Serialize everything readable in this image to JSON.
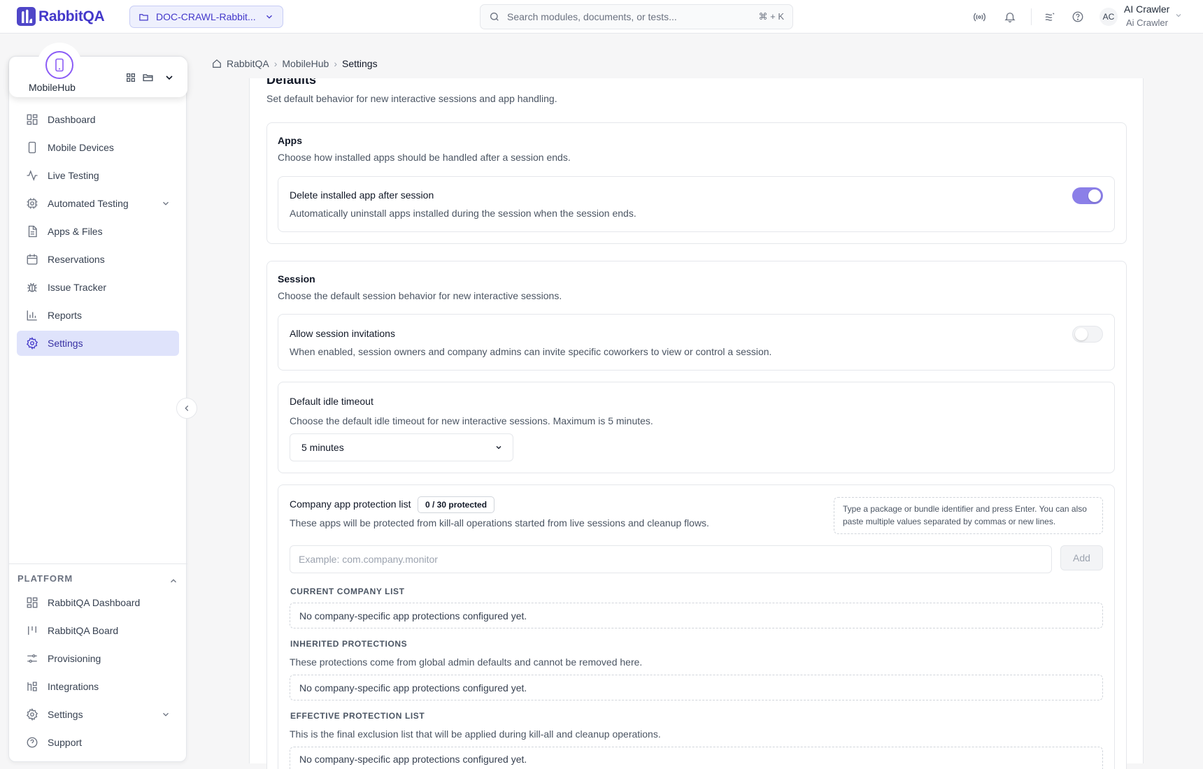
{
  "topbar": {
    "logo_text": "RabbitQA",
    "project_selector": "DOC-CRAWL-Rabbit...",
    "search_placeholder": "Search modules, documents, or tests...",
    "search_shortcut": "⌘ + K",
    "user": {
      "initials": "AC",
      "name": "AI Crawler",
      "role": "Ai Crawler"
    }
  },
  "sidebar": {
    "module": {
      "name": "MobileHub"
    },
    "items": [
      {
        "label": "Dashboard",
        "icon": "dashboard-icon"
      },
      {
        "label": "Mobile Devices",
        "icon": "mobile-icon"
      },
      {
        "label": "Live Testing",
        "icon": "activity-icon"
      },
      {
        "label": "Automated Testing",
        "icon": "cpu-icon",
        "expandable": true
      },
      {
        "label": "Apps & Files",
        "icon": "file-icon"
      },
      {
        "label": "Reservations",
        "icon": "calendar-icon"
      },
      {
        "label": "Issue Tracker",
        "icon": "bug-icon"
      },
      {
        "label": "Reports",
        "icon": "chart-icon"
      },
      {
        "label": "Settings",
        "icon": "gear-icon",
        "active": true
      }
    ],
    "platform": {
      "header": "PLATFORM",
      "items": [
        {
          "label": "RabbitQA Dashboard",
          "icon": "dashboard-icon"
        },
        {
          "label": "RabbitQA Board",
          "icon": "board-icon"
        },
        {
          "label": "Provisioning",
          "icon": "sliders-icon"
        },
        {
          "label": "Integrations",
          "icon": "integrations-icon"
        },
        {
          "label": "Settings",
          "icon": "gear-icon",
          "expandable": true
        },
        {
          "label": "Support",
          "icon": "help-icon"
        }
      ]
    }
  },
  "breadcrumb": {
    "home": "RabbitQA",
    "module": "MobileHub",
    "current": "Settings"
  },
  "defaults": {
    "title": "Defaults",
    "description": "Set default behavior for new interactive sessions and app handling.",
    "apps": {
      "title": "Apps",
      "description": "Choose how installed apps should be handled after a session ends.",
      "delete_app": {
        "title": "Delete installed app after session",
        "description": "Automatically uninstall apps installed during the session when the session ends.",
        "enabled": true
      }
    },
    "session": {
      "title": "Session",
      "description": "Choose the default session behavior for new interactive sessions.",
      "invitations": {
        "title": "Allow session invitations",
        "description": "When enabled, session owners and company admins can invite specific coworkers to view or control a session.",
        "enabled": false
      },
      "idle_timeout": {
        "title": "Default idle timeout",
        "description": "Choose the default idle timeout for new interactive sessions. Maximum is 5 minutes.",
        "selected": "5 minutes"
      },
      "protection": {
        "title": "Company app protection list",
        "badge": "0 / 30 protected",
        "description": "These apps will be protected from kill-all operations started from live sessions and cleanup flows.",
        "hint": "Type a package or bundle identifier and press Enter. You can also paste multiple values separated by commas or new lines.",
        "input_placeholder": "Example: com.company.monitor",
        "add_label": "Add",
        "current_header": "CURRENT COMPANY LIST",
        "current_empty": "No company-specific app protections configured yet.",
        "inherited_header": "INHERITED PROTECTIONS",
        "inherited_desc": "These protections come from global admin defaults and cannot be removed here.",
        "inherited_empty": "No company-specific app protections configured yet.",
        "effective_header": "EFFECTIVE PROTECTION LIST",
        "effective_desc": "This is the final exclusion list that will be applied during kill-all and cleanup operations.",
        "effective_empty": "No company-specific app protections configured yet."
      }
    }
  },
  "colors": {
    "accent": "#4338ca",
    "toggle_on": "#8b7fe8",
    "active_nav": "#dfe3fb",
    "module_ring": "#8b5cf6"
  }
}
